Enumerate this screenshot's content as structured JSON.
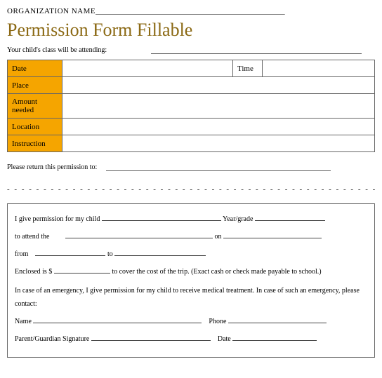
{
  "header": {
    "org_label": "ORGANIZATION NAME",
    "org_blank": "_________________________________________________",
    "title": "Permission Form Fillable",
    "attending_label": "Your child's class will be attending:"
  },
  "details": {
    "date_label": "Date",
    "date_value": "",
    "time_label": "Time",
    "time_value": "",
    "place_label": "Place",
    "place_value": "",
    "amount_label": "Amount needed",
    "amount_value": "",
    "location_label": "Location",
    "location_value": "",
    "instruction_label": "Instruction",
    "instruction_value": ""
  },
  "return_label": "Please return this permission to:",
  "return_value": "",
  "slip": {
    "line1_a": "I give permission for my child",
    "line1_b": "Year/grade",
    "line2_a": "to attend the",
    "line2_b": "on",
    "line3_a": "from",
    "line3_b": "to",
    "line4_a": "Enclosed is $",
    "line4_b": "to cover the cost of the trip. (Exact cash or check made payable to school.)",
    "emergency": "In case of an emergency, I give permission for my child to receive medical treatment. In case of such an emergency, please contact:",
    "name_label": "Name",
    "phone_label": "Phone",
    "sig_label": "Parent/Guardian Signature",
    "sig_date_label": "Date"
  }
}
